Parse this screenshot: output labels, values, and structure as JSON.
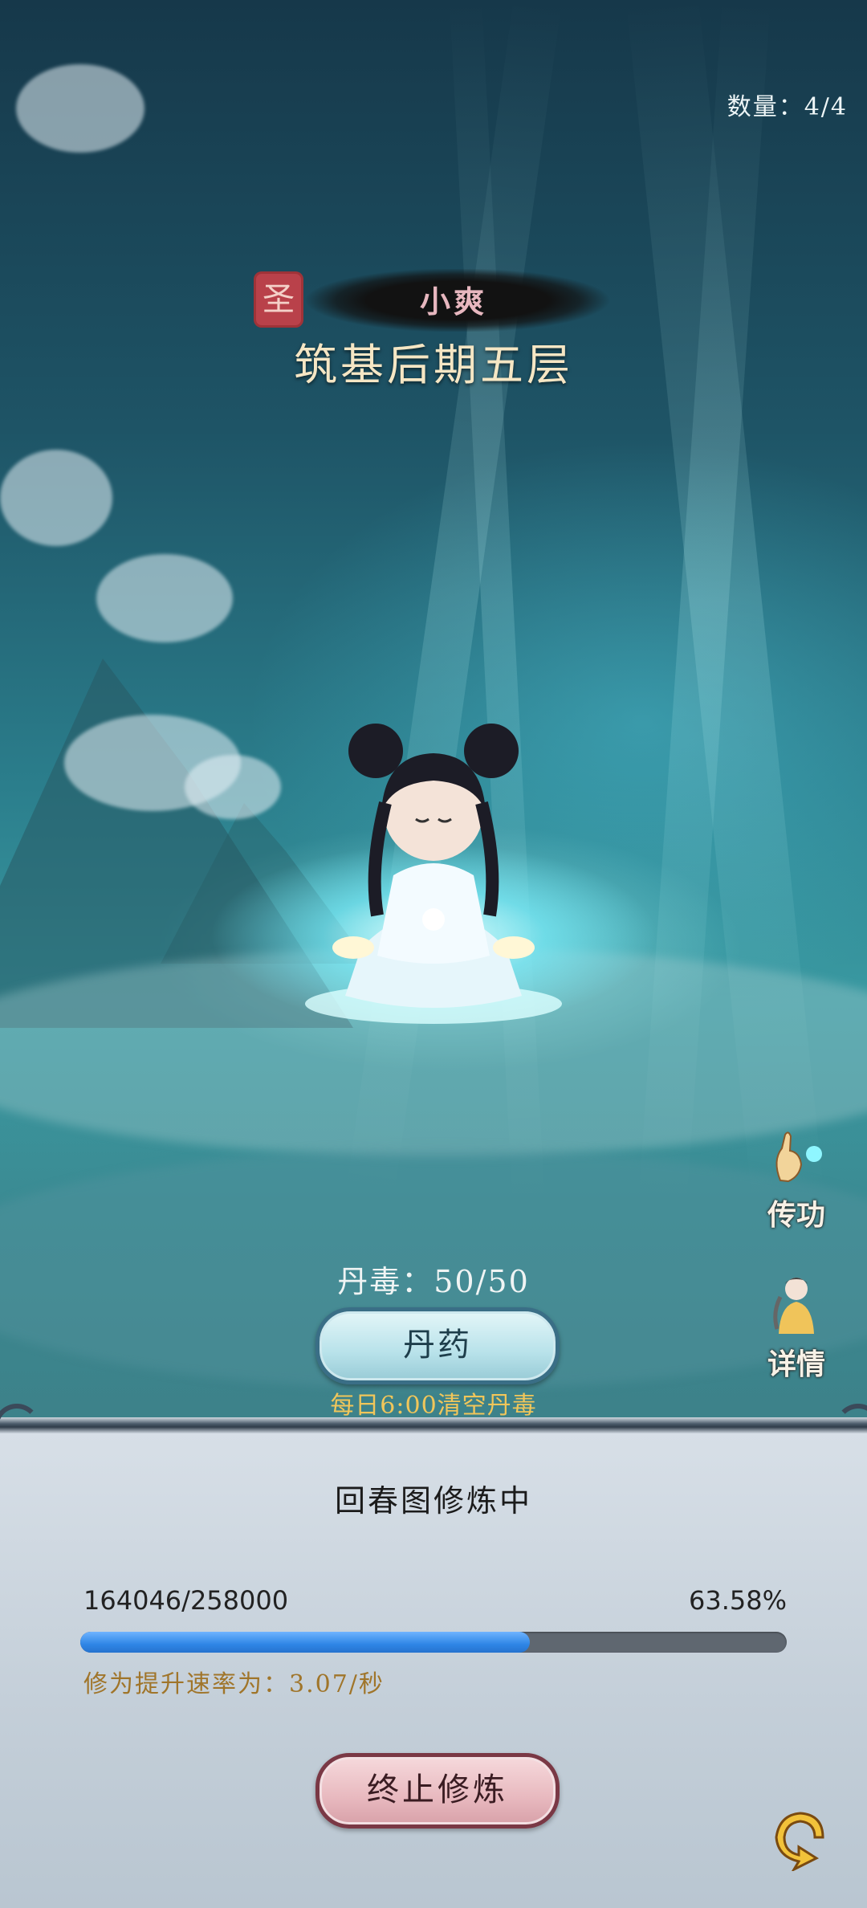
{
  "header": {
    "count_text": "数量：4/4"
  },
  "character": {
    "seal_glyph": "圣",
    "name": "小爽",
    "realm": "筑基后期五层"
  },
  "side_actions": [
    {
      "label": "传功",
      "icon": "hand-icon"
    },
    {
      "label": "详情",
      "icon": "character-portrait-icon"
    }
  ],
  "pill": {
    "toxin_text": "丹毒：50/50",
    "button_label": "丹药",
    "reset_note": "每日6:00清空丹毒"
  },
  "cultivation": {
    "title": "回春图修炼中",
    "progress_text": "164046/258000",
    "progress_percent_text": "63.58%",
    "progress_fraction": 0.6358,
    "rate_text": "修为提升速率为：3.07/秒",
    "stop_label": "终止修炼"
  },
  "colors": {
    "progress_fill": "#2f86e6",
    "rate_text": "#a0752a",
    "reset_note": "#f1c65a",
    "name_text": "#e7b7bf"
  }
}
